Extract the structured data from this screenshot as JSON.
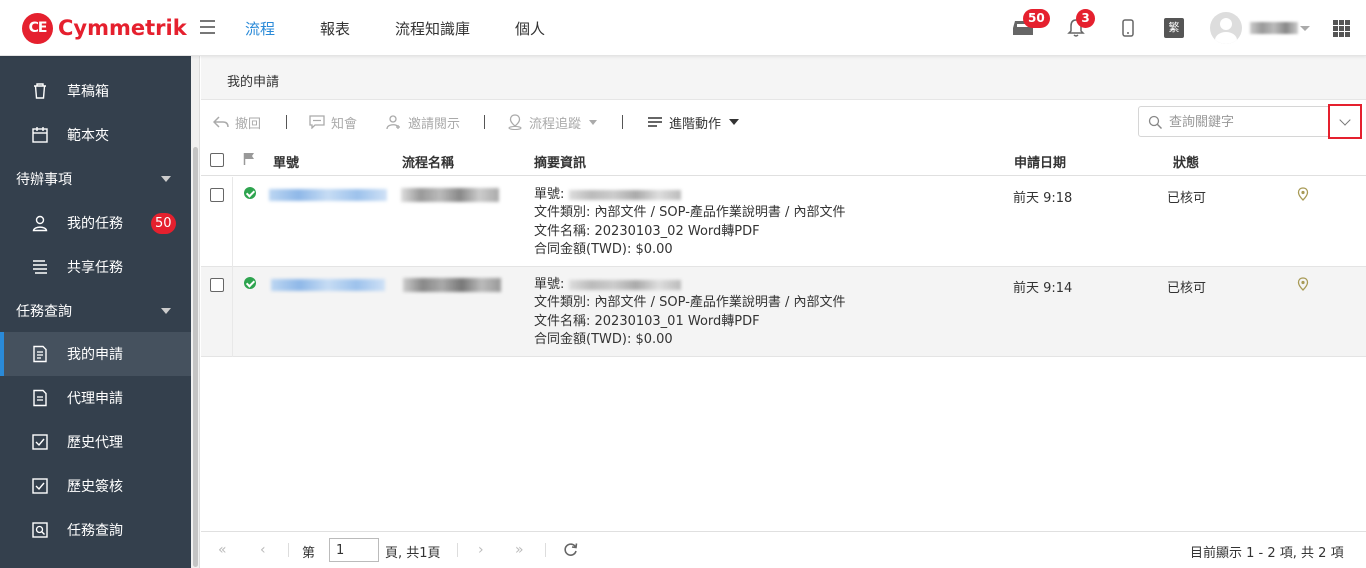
{
  "brand": {
    "name": "Cymmetrik",
    "mark": "CE"
  },
  "nav": [
    "流程",
    "報表",
    "流程知識庫",
    "個人"
  ],
  "header": {
    "inbox_badge": "50",
    "bell_badge": "3",
    "lang": "繁"
  },
  "sidebar": {
    "items": [
      {
        "label": "草稿箱",
        "icon": "trash-icon"
      },
      {
        "label": "範本夾",
        "icon": "calendar-icon"
      }
    ],
    "group1": "待辦事項",
    "group1_items": [
      {
        "label": "我的任務",
        "icon": "user-icon",
        "badge": "50"
      },
      {
        "label": "共享任務",
        "icon": "shared-tasks-icon"
      }
    ],
    "group2": "任務查詢",
    "group2_items": [
      {
        "label": "我的申請",
        "icon": "application-icon"
      },
      {
        "label": "代理申請",
        "icon": "document-icon"
      },
      {
        "label": "歷史代理",
        "icon": "history-check-icon"
      },
      {
        "label": "歷史簽核",
        "icon": "signoff-check-icon"
      },
      {
        "label": "任務查詢",
        "icon": "search-doc-icon"
      }
    ]
  },
  "breadcrumb": "我的申請",
  "toolbar": {
    "withdraw": "撤回",
    "notify": "知會",
    "invite": "邀請閱示",
    "trace": "流程追蹤",
    "advanced": "進階動作"
  },
  "search": {
    "placeholder": "查詢關鍵字"
  },
  "table": {
    "headers": {
      "no": "單號",
      "flow": "流程名稱",
      "summary": "摘要資訊",
      "date": "申請日期",
      "status": "狀態"
    },
    "rows": [
      {
        "summary_no_label": "單號:",
        "doc_type": "文件類別: 內部文件 / SOP-產品作業說明書 / 內部文件",
        "doc_name": "文件名稱: 20230103_02 Word轉PDF",
        "amount": "合同金額(TWD): $0.00",
        "date": "前天 9:18",
        "status": "已核可"
      },
      {
        "summary_no_label": "單號:",
        "doc_type": "文件類別: 內部文件 / SOP-產品作業說明書 / 內部文件",
        "doc_name": "文件名稱: 20230103_01 Word轉PDF",
        "amount": "合同金額(TWD): $0.00",
        "date": "前天 9:14",
        "status": "已核可"
      }
    ]
  },
  "pager": {
    "page_prefix": "第",
    "page_value": "1",
    "page_suffix": "頁, 共1頁",
    "summary": "目前顯示 1 - 2 項, 共 2 項"
  },
  "colors": {
    "brand_red": "#e5202e",
    "sidebar_bg": "#34404d",
    "active_blue": "#2a8ad8"
  }
}
